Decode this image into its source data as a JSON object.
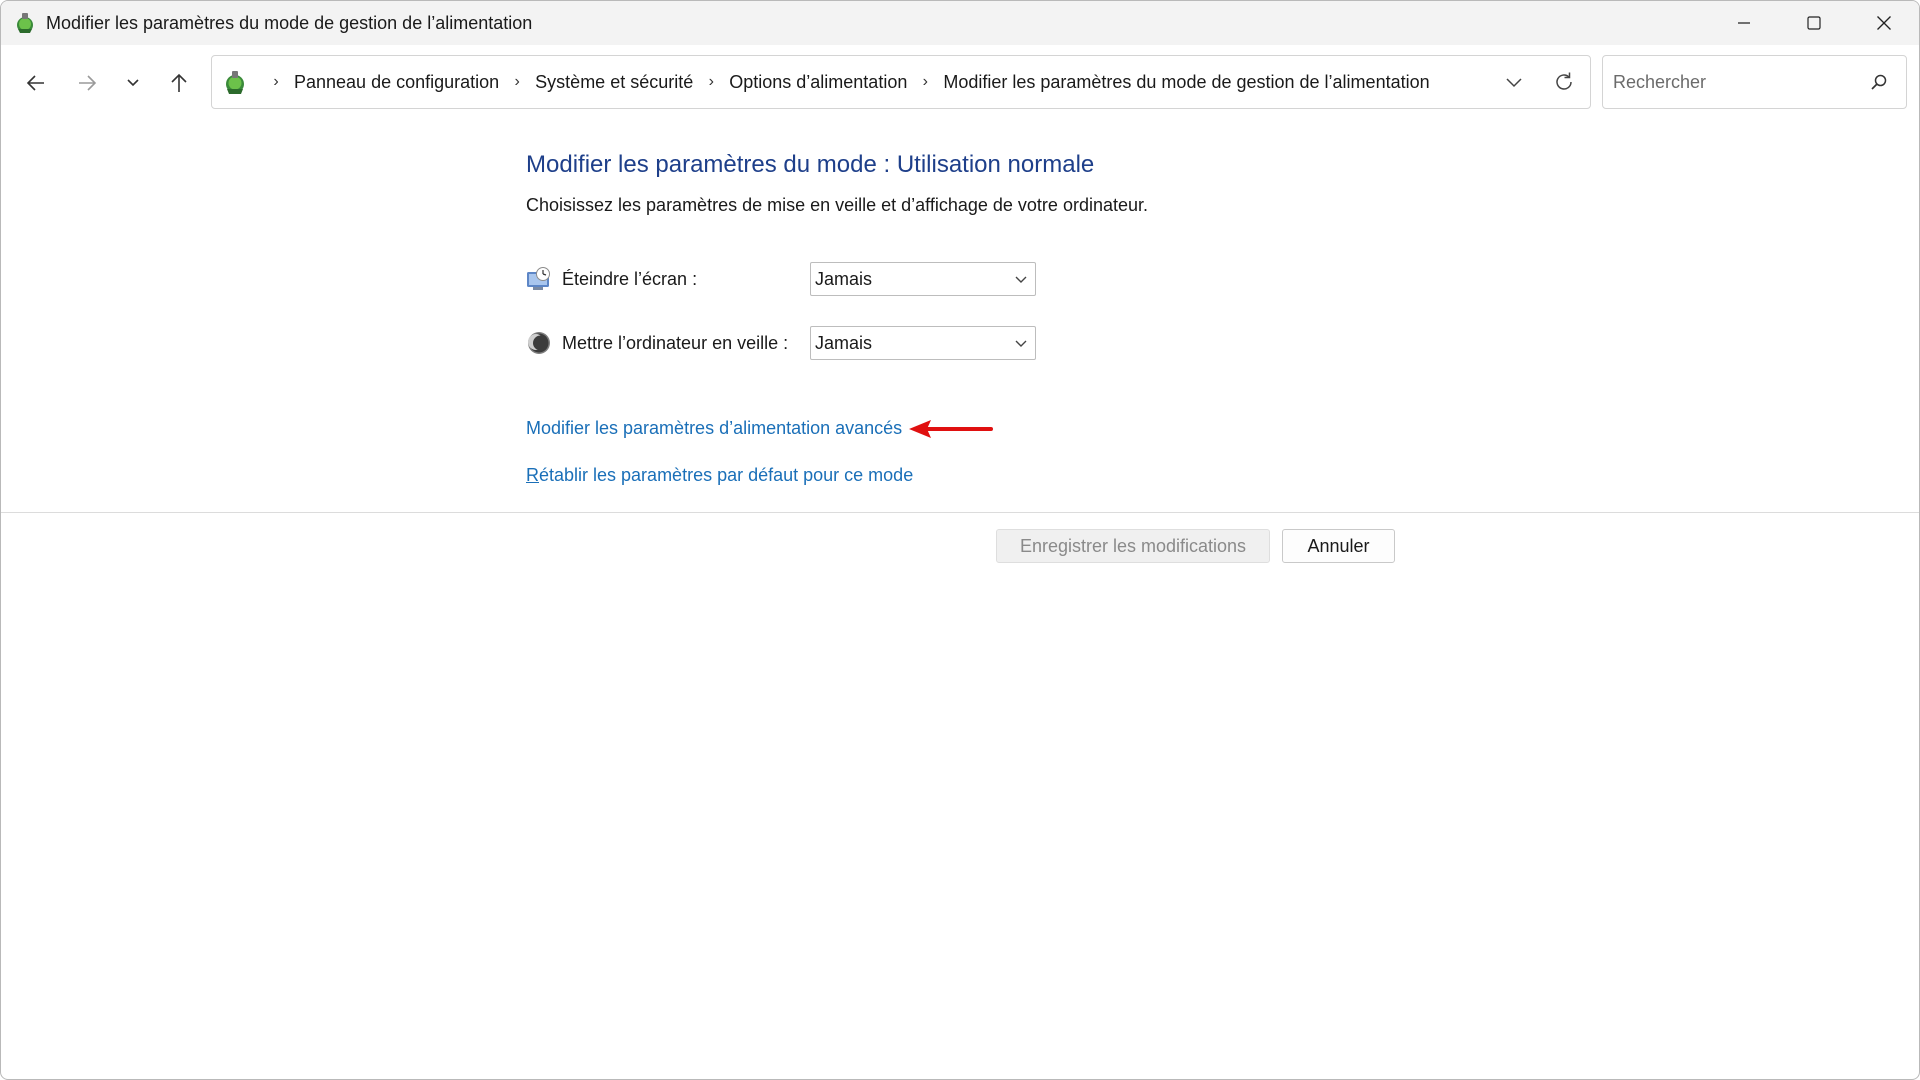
{
  "window": {
    "title": "Modifier les paramètres du mode de gestion de l’alimentation"
  },
  "address_bar": {
    "crumbs": [
      "Panneau de configuration",
      "Système et sécurité",
      "Options d’alimentation",
      "Modifier les paramètres du mode de gestion de l’alimentation"
    ],
    "separator": "›"
  },
  "search": {
    "placeholder": "Rechercher",
    "value": ""
  },
  "main": {
    "title": "Modifier les paramètres du mode : Utilisation normale",
    "subtitle": "Choisissez les paramètres de mise en veille et d’affichage de votre ordinateur.",
    "settings": [
      {
        "label": "Éteindre l’écran :",
        "value": "Jamais",
        "icon": "display-off-icon"
      },
      {
        "label": "Mettre l’ordinateur en veille :",
        "value": "Jamais",
        "icon": "sleep-moon-icon"
      }
    ],
    "links": {
      "advanced": "Modifier les paramètres d’alimentation avancés",
      "restore_first": "R",
      "restore_rest": "établir les paramètres par défaut pour ce mode"
    }
  },
  "buttons": {
    "save": "Enregistrer les modifications",
    "cancel": "Annuler"
  },
  "colors": {
    "title": "#1e3f8a",
    "link": "#1a6fb8",
    "annotation_arrow": "#e01010"
  }
}
